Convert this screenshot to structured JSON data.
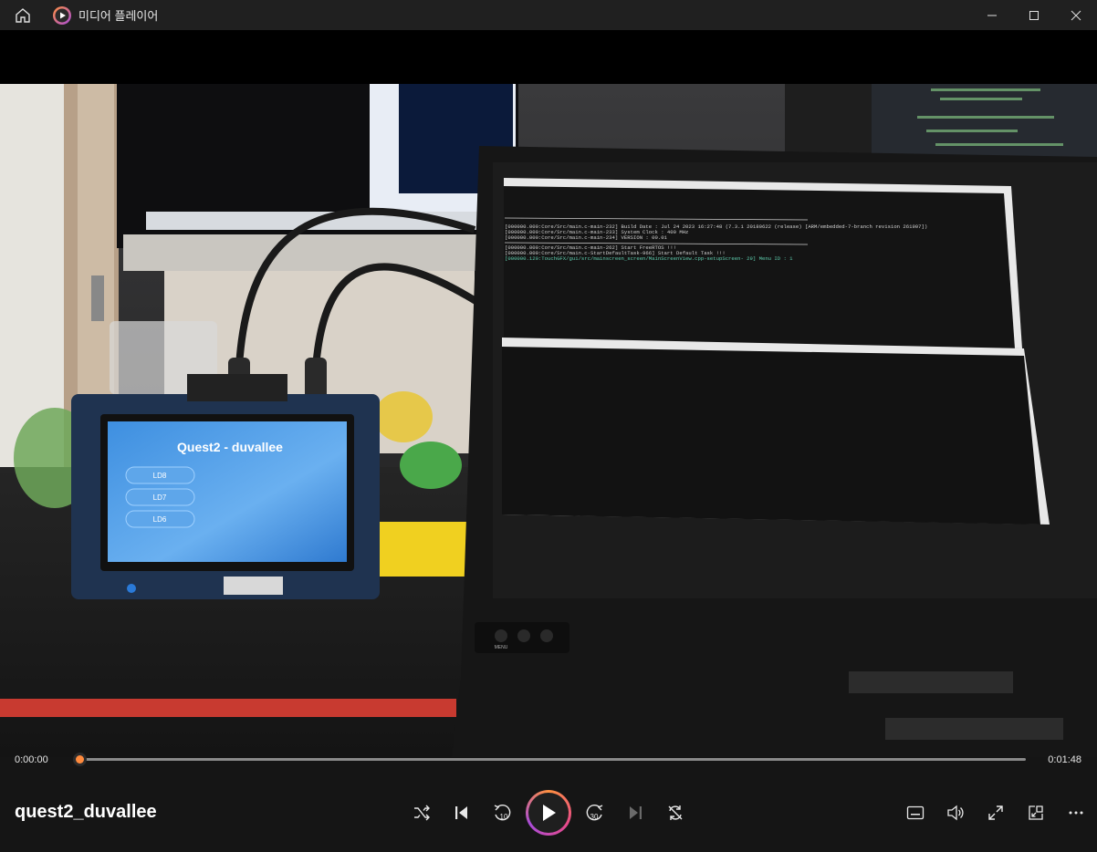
{
  "window": {
    "app_title": "미디어 플레이어"
  },
  "player": {
    "media_title": "quest2_duvallee",
    "elapsed": "0:00:00",
    "duration": "0:01:48",
    "progress": 0.0
  },
  "video_content": {
    "device_screen_title": "Quest2 - duvallee",
    "device_buttons": [
      "LD8",
      "LD7",
      "LD6"
    ],
    "monitor_button_label": "MENU",
    "terminal_lines": [
      "[000000.000:Core/Src/main.c-main-232] Build Date   : Jul 24 2023 16:27:48 (7.3.1 20180622 (release) [ARM/embedded-7-branch revision 261907])",
      "[000000.000:Core/Src/main.c-main-233] System Clock : 400 MHz",
      "[000000.000:Core/Src/main.c-main-234] VERSION      : 00.01",
      "[000000.000:Core/Src/main.c-main-262] Start FreeRTOS !!!",
      "[000000.000:Core/Src/main.c-StartDefaultTask-966] Start Default Task !!!",
      "[000000.120:TouchGFX/gui/src/mainscreen_screen/MainScreenView.cpp-setupScreen- 29] Menu ID : 1"
    ]
  },
  "icons": {
    "home": "home-icon",
    "app": "media-player-icon",
    "minimize": "minimize-icon",
    "maximize": "maximize-icon",
    "close": "close-icon",
    "shuffle": "shuffle-icon",
    "previous": "previous-icon",
    "skip_back": "skip-back-10-icon",
    "play": "play-icon",
    "skip_forward": "skip-forward-30-icon",
    "next": "next-icon",
    "repeat": "repeat-icon",
    "subtitles": "subtitles-icon",
    "volume": "volume-icon",
    "fullscreen": "fullscreen-icon",
    "miniplayer": "miniplayer-icon",
    "more": "more-icon"
  },
  "colors": {
    "accent": "#ff8a3d",
    "play_gradient": [
      "#ff9040",
      "#e84a8a",
      "#a84cd8"
    ],
    "titlebar": "#202020",
    "controlbar": "#161616"
  }
}
